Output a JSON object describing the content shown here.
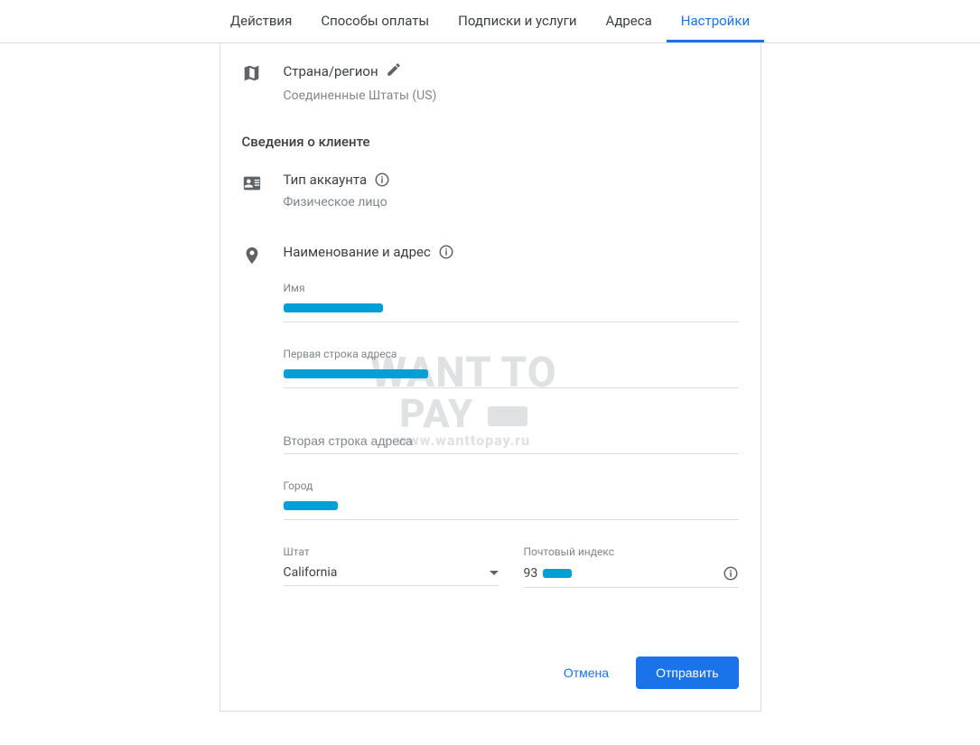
{
  "tabs": {
    "actions": "Действия",
    "payment_methods": "Способы оплаты",
    "subscriptions": "Подписки и услуги",
    "addresses": "Адреса",
    "settings": "Настройки"
  },
  "country_region": {
    "title": "Страна/регион",
    "value": "Соединенные Штаты (US)"
  },
  "customer_info_heading": "Сведения о клиенте",
  "account_type": {
    "title": "Тип аккаунта",
    "value": "Физическое лицо"
  },
  "name_address": {
    "title": "Наименование и адрес"
  },
  "form": {
    "name_label": "Имя",
    "addr1_label": "Первая строка адреса",
    "addr2_placeholder": "Вторая строка адреса",
    "city_label": "Город",
    "state_label": "Штат",
    "state_value": "California",
    "zip_label": "Почтовый индекс",
    "zip_prefix": "93"
  },
  "buttons": {
    "cancel": "Отмена",
    "submit": "Отправить"
  },
  "watermark": {
    "line1": "WANT TO",
    "line2": "PAY",
    "url": "www.wanttopay.ru"
  }
}
